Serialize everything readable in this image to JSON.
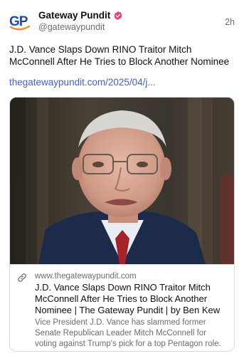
{
  "author": {
    "display_name": "Gateway Pundit",
    "handle": "@gatewaypundit",
    "avatar_text": "GP",
    "verified": true
  },
  "post": {
    "timestamp": "2h",
    "text": "J.D. Vance Slaps Down RINO Traitor Mitch McConnell After He Tries to Block Another Nominee",
    "link_text": "thegatewaypundit.com/2025/04/j..."
  },
  "link_card": {
    "image_icon": "photo-of-mitch-mcconnell",
    "domain": "www.thegatewaypundit.com",
    "title": "J.D. Vance Slaps Down RINO Traitor Mitch McConnell After He Tries to Block Another Nominee | The Gateway Pundit | by Ben Kew",
    "description": "Vice President J.D. Vance has slammed former Senate Republican Leader Mitch McConnell for voting against Trump's pick for a top Pentagon role."
  },
  "colors": {
    "link": "#3f5ee0",
    "verified_badge": "#e8417f",
    "avatar_blue": "#1f4e9e",
    "avatar_orange": "#f08a24",
    "muted_text": "#6b6e78"
  }
}
